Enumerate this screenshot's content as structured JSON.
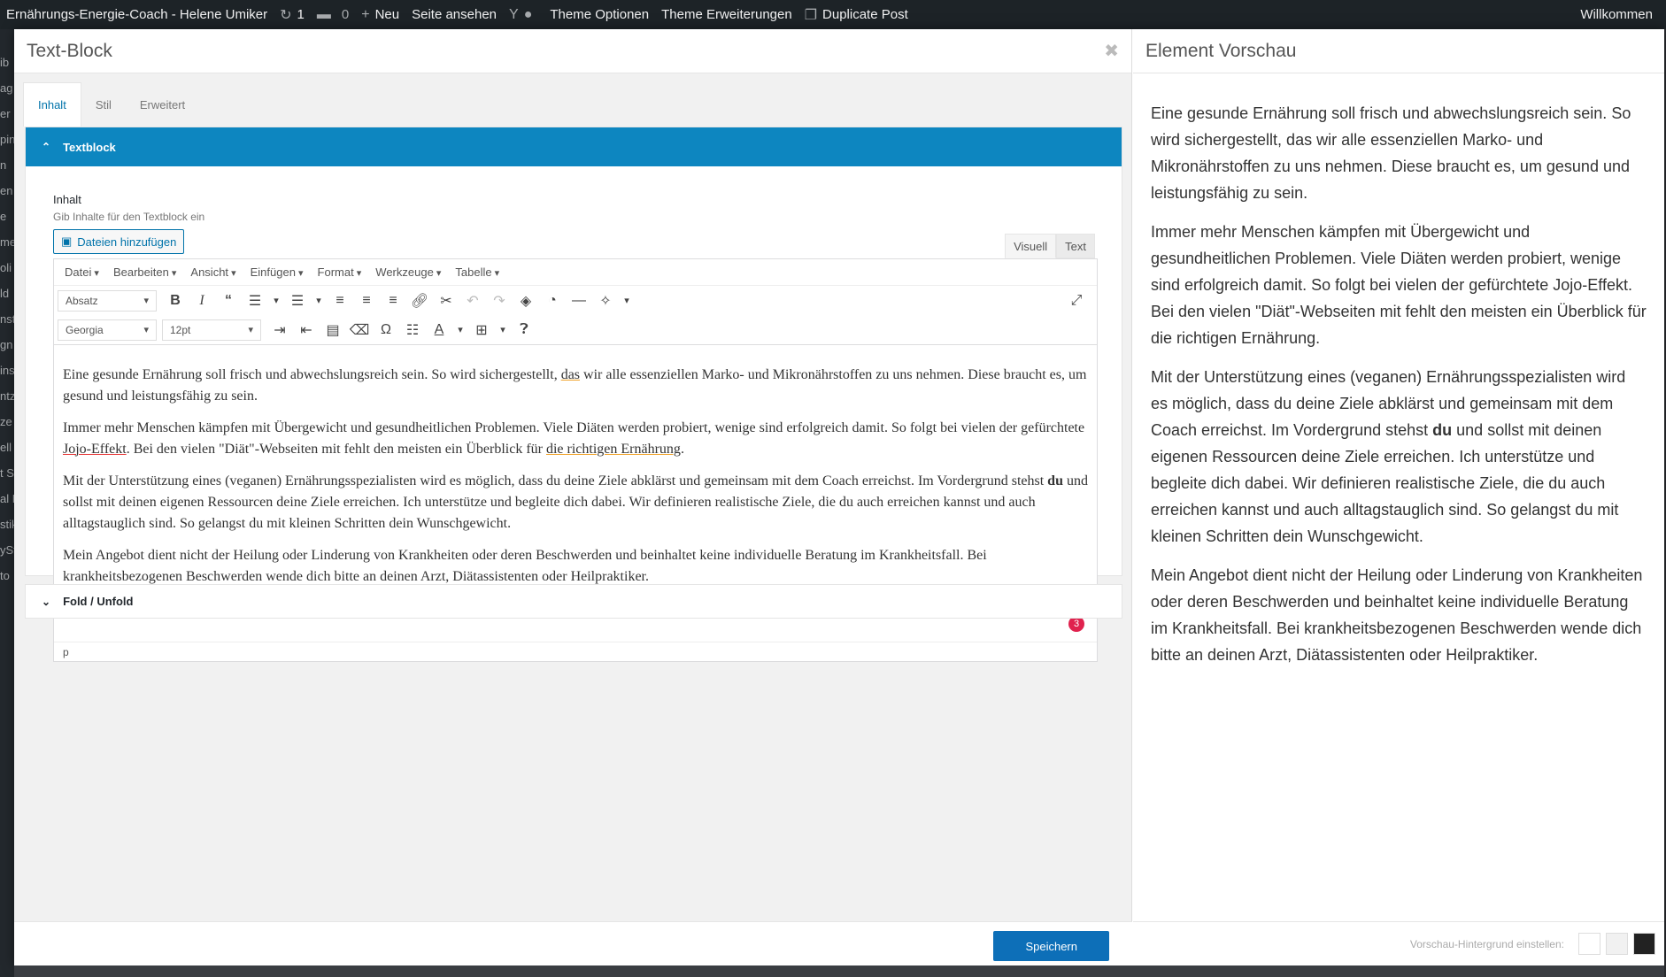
{
  "adminbar": {
    "site_name": "Ernährungs-Energie-Coach - Helene Umiker",
    "updates_count": "1",
    "comments_count": "0",
    "new_label": "Neu",
    "view_page": "Seite ansehen",
    "theme_options": "Theme Optionen",
    "theme_extensions": "Theme Erweiterungen",
    "duplicate_post": "Duplicate Post",
    "welcome": "Willkommen"
  },
  "sidebar_fragments": [
    "ib",
    "ag",
    "er",
    "pin",
    "n",
    "en",
    "e",
    "me",
    "oli",
    "ld",
    "nst",
    "gn",
    "ins",
    "ntz",
    "ze",
    "ell",
    "t S",
    "al F",
    "stik",
    "ySt",
    "to"
  ],
  "modal": {
    "title": "Text-Block",
    "tabs": [
      "Inhalt",
      "Stil",
      "Erweitert"
    ],
    "section_textblock": "Textblock",
    "section_fold": "Fold / Unfold",
    "field_label": "Inhalt",
    "field_desc": "Gib Inhalte für den Textblock ein",
    "add_media": "Dateien hinzufügen",
    "mode_visual": "Visuell",
    "mode_text": "Text",
    "menus": [
      "Datei",
      "Bearbeiten",
      "Ansicht",
      "Einfügen",
      "Format",
      "Werkzeuge",
      "Tabelle"
    ],
    "block_format": "Absatz",
    "font_family": "Georgia",
    "font_size": "12pt",
    "status_path": "p",
    "badge_count": "3",
    "save": "Speichern"
  },
  "content": {
    "p1_a": "Eine gesunde Ernährung soll frisch und abwechslungsreich sein. So wird sichergestellt, ",
    "p1_b": "das",
    "p1_c": " wir alle essenziellen Marko- und Mikronährstoffen zu uns nehmen. Diese braucht es, um gesund und leistungsfähig zu sein.",
    "p2_a": "Immer mehr Menschen kämpfen mit Übergewicht und gesundheitlichen Problemen. Viele Diäten werden probiert, wenige sind erfolgreich damit. So folgt bei vielen der gefürchtete ",
    "p2_b": "Jojo-Effekt",
    "p2_c": ". Bei den vielen \"Diät\"-Webseiten mit fehlt den meisten ein Überblick für ",
    "p2_d": "die richtigen Ernährung",
    "p2_e": ".",
    "p3_a": "Mit der Unterstützung eines (veganen) Ernährungsspezialisten wird es möglich, dass du deine Ziele abklärst und gemeinsam mit dem Coach erreichst. Im Vordergrund stehst ",
    "p3_b": "du",
    "p3_c": " und sollst mit deinen eigenen Ressourcen deine Ziele erreichen. Ich unterstütze und begleite dich dabei. Wir definieren realistische Ziele, die du auch erreichen kannst und auch alltagstauglich sind. So gelangst du mit kleinen Schritten dein Wunschgewicht.",
    "p4": "Mein Angebot dient nicht der Heilung oder Linderung von Krankheiten oder deren Beschwerden und beinhaltet keine individuelle Beratung im Krankheitsfall. Bei krankheitsbezogenen Beschwerden wende dich bitte an deinen Arzt, Diätassistenten oder Heilpraktiker."
  },
  "preview": {
    "title": "Element Vorschau",
    "p1": "Eine gesunde Ernährung soll frisch und abwechslungsreich sein. So wird sichergestellt, das wir alle essenziellen Marko- und Mikronährstoffen zu uns nehmen. Diese braucht es, um gesund und leistungsfähig zu sein.",
    "p2": "Immer mehr Menschen kämpfen mit Übergewicht und gesundheitlichen Problemen. Viele Diäten werden probiert, wenige sind erfolgreich damit. So folgt bei vielen der gefürchtete Jojo-Effekt. Bei den vielen \"Diät\"-Webseiten mit fehlt den meisten ein Überblick für die richtigen Ernährung.",
    "p3_a": "Mit der Unterstützung eines (veganen) Ernährungsspezialisten wird es möglich, dass du deine Ziele abklärst und gemeinsam mit dem Coach erreichst. Im Vordergrund stehst ",
    "p3_b": "du",
    "p3_c": " und sollst mit deinen eigenen Ressourcen deine Ziele erreichen. Ich unterstütze und begleite dich dabei. Wir definieren realistische Ziele, die du auch erreichen kannst und auch alltagstauglich sind. So gelangst du mit kleinen Schritten dein Wunschgewicht.",
    "p4": "Mein Angebot dient nicht der Heilung oder Linderung von Krankheiten oder deren Beschwerden und beinhaltet keine individuelle Beratung im Krankheitsfall. Bei krankheitsbezogenen Beschwerden wende dich bitte an deinen Arzt, Diätassistenten oder Heilpraktiker.",
    "bg_label": "Vorschau-Hintergrund einstellen:",
    "swatches": [
      "#ffffff",
      "#f1f1f1",
      "#222222"
    ]
  },
  "colors": {
    "accent": "#0d86c0",
    "save_button": "#0d6fb8",
    "admin_bar": "#1d2327",
    "badge": "#e0224e"
  }
}
